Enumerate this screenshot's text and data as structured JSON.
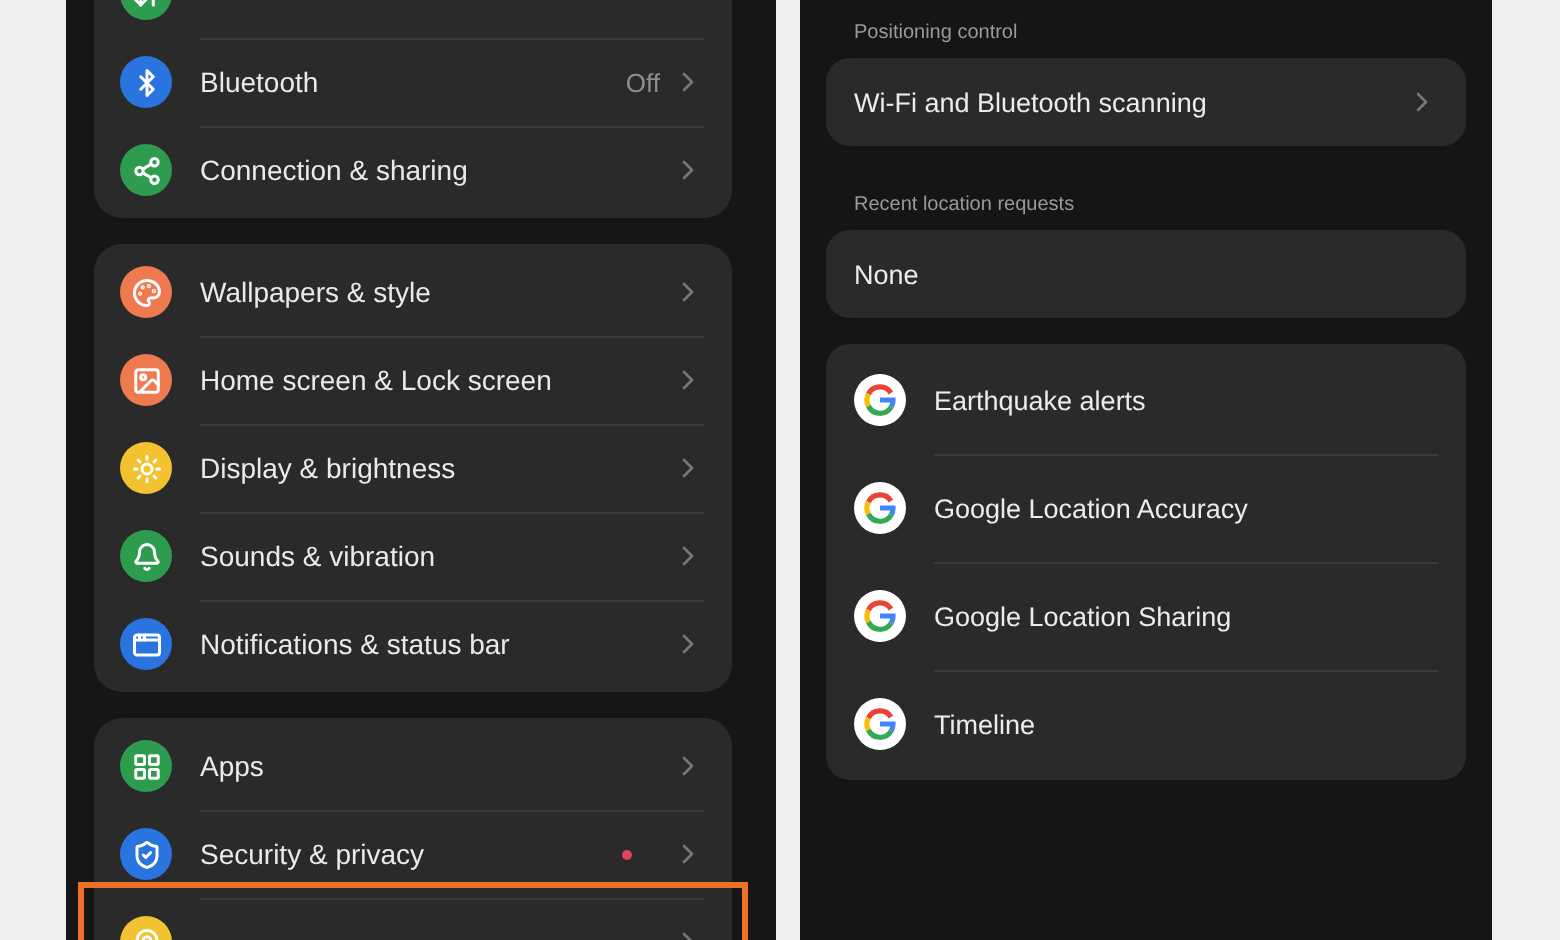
{
  "settings_list": {
    "groups": [
      {
        "items": [
          {
            "color": "#2e9c4e",
            "chevron": false
          },
          {
            "label": "Bluetooth",
            "color": "#2a74e0",
            "value": "Off"
          },
          {
            "label": "Connection & sharing",
            "color": "#2e9c4e"
          }
        ]
      },
      {
        "items": [
          {
            "label": "Wallpapers & style",
            "color": "#ef7a4f"
          },
          {
            "label": "Home screen & Lock screen",
            "color": "#ef7a4f"
          },
          {
            "label": "Display & brightness",
            "color": "#f2c230"
          },
          {
            "label": "Sounds & vibration",
            "color": "#2e9c4e"
          },
          {
            "label": "Notifications & status bar",
            "color": "#2a74e0"
          }
        ]
      },
      {
        "items": [
          {
            "label": "Apps",
            "color": "#2e9c4e"
          },
          {
            "label": "Security & privacy",
            "color": "#2a74e0",
            "badge": true
          },
          {
            "color": "#f2c230",
            "highlighted": true,
            "chevron": true
          }
        ]
      }
    ]
  },
  "location_screen": {
    "sections": [
      {
        "heading": "Positioning control",
        "rows": [
          {
            "label": "Wi-Fi and Bluetooth scanning",
            "chevron": true
          }
        ]
      },
      {
        "heading": "Recent location requests",
        "rows": [
          {
            "label": "None",
            "chevron": false
          }
        ]
      }
    ],
    "services": [
      {
        "label": "Earthquake alerts"
      },
      {
        "label": "Google Location Accuracy"
      },
      {
        "label": "Google Location Sharing"
      },
      {
        "label": "Timeline"
      }
    ]
  }
}
